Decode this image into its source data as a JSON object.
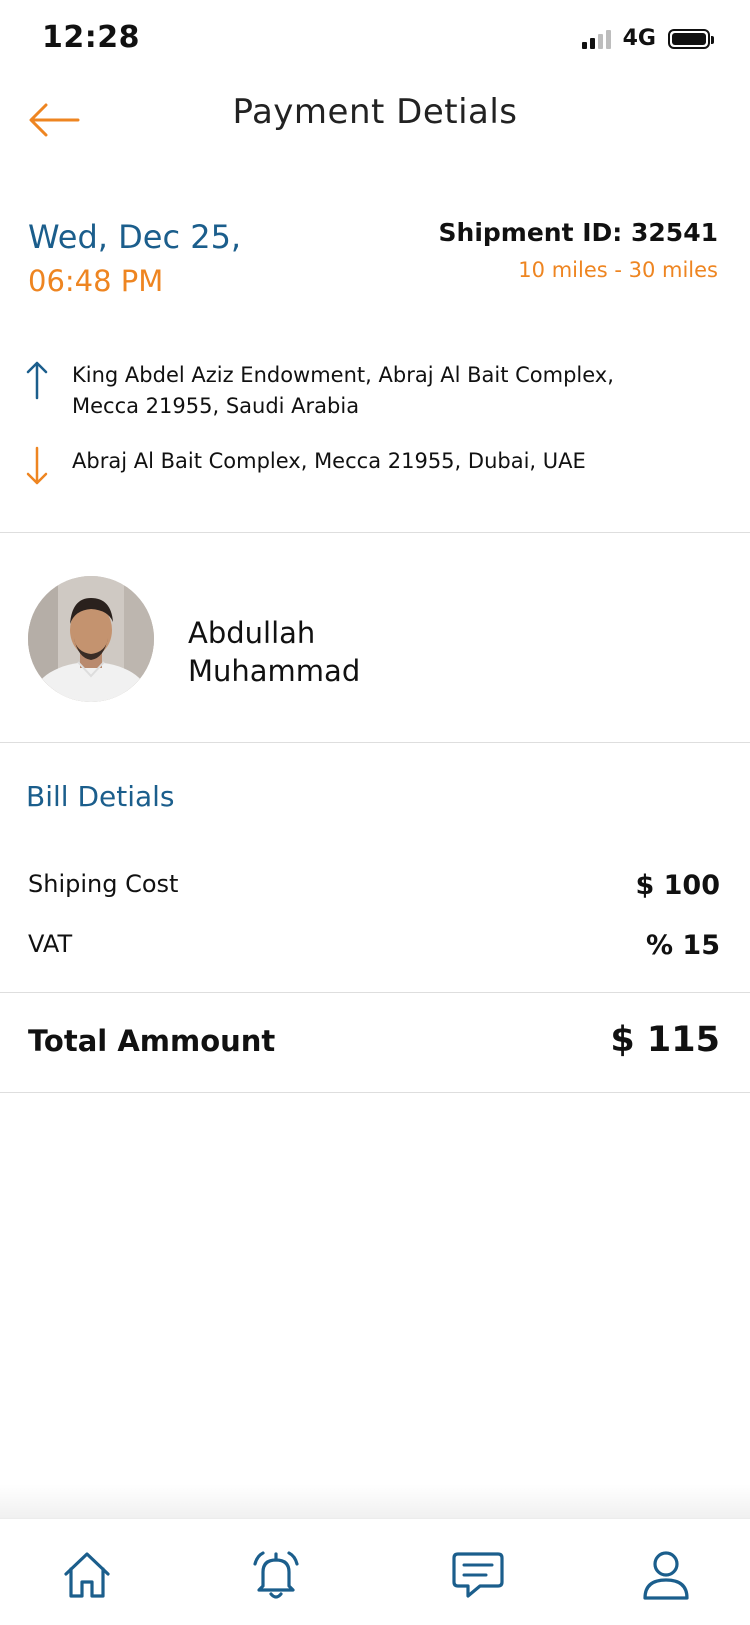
{
  "status_bar": {
    "time": "12:28",
    "network": "4G"
  },
  "header": {
    "title": "Payment Detials"
  },
  "shipment": {
    "date": "Wed, Dec 25,",
    "time": "06:48 PM",
    "id_label": "Shipment ID: 32541",
    "distance": "10 miles - 30 miles",
    "pickup": "King Abdel Aziz Endowment, Abraj Al Bait Complex, Mecca 21955, Saudi Arabia",
    "dropoff": "Abraj Al Bait Complex, Mecca 21955, Dubai, UAE"
  },
  "driver": {
    "name": "Abdullah Muhammad"
  },
  "bill": {
    "title": "Bill Detials",
    "rows": [
      {
        "label": "Shiping Cost",
        "value": "$ 100"
      },
      {
        "label": "VAT",
        "value": "% 15"
      }
    ],
    "total_label": "Total Ammount",
    "total_value": "$ 115"
  },
  "nav": {
    "items": [
      "home-icon",
      "bell-icon",
      "chat-icon",
      "profile-icon"
    ]
  },
  "colors": {
    "accent_orange": "#ee8521",
    "accent_blue": "#1b5e8c",
    "nav_icon": "#1b5e8c"
  }
}
